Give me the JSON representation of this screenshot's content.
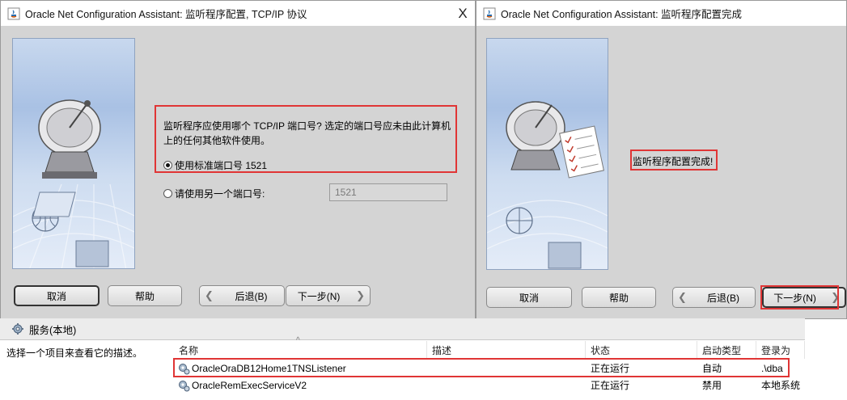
{
  "left_window": {
    "title": "Oracle Net Configuration Assistant: 监听程序配置, TCP/IP 协议",
    "close_glyph": "X",
    "prompt_line1": "监听程序应使用哪个 TCP/IP 端口号? 选定的端口号应未由此计算机",
    "prompt_line2": "上的任何其他软件使用。",
    "option_standard": "使用标准端口号 1521",
    "option_other": "请使用另一个端口号:",
    "port_value": "1521",
    "buttons": {
      "cancel": "取消",
      "help": "帮助",
      "back": "后退(B)",
      "next": "下一步(N)"
    }
  },
  "right_window": {
    "title": "Oracle Net Configuration Assistant: 监听程序配置完成",
    "message": "监听程序配置完成!",
    "buttons": {
      "cancel": "取消",
      "help": "帮助",
      "back": "后退(B)",
      "next": "下一步(N)"
    }
  },
  "services": {
    "header_title": "服务(本地)",
    "description_hint": "选择一个项目来查看它的描述。",
    "sort_glyph": "^",
    "columns": [
      "名称",
      "描述",
      "状态",
      "启动类型",
      "登录为"
    ],
    "rows": [
      {
        "name": "OracleOraDB12Home1TNSListener",
        "desc": "",
        "status": "正在运行",
        "startup": "自动",
        "logon": ".\\dba"
      },
      {
        "name": "OracleRemExecServiceV2",
        "desc": "",
        "status": "正在运行",
        "startup": "禁用",
        "logon": "本地系统"
      }
    ]
  },
  "colors": {
    "highlight": "#e03535",
    "dialog_bg": "#d4d4d4"
  }
}
